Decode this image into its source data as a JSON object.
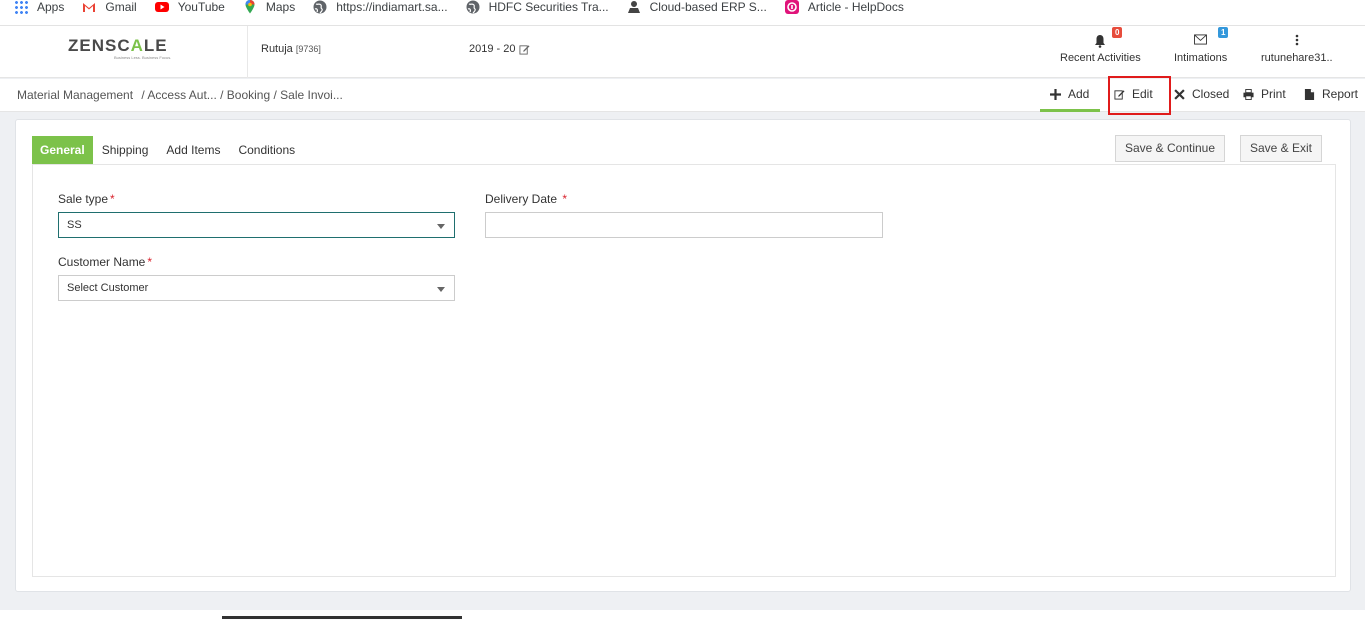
{
  "bookmarks": [
    {
      "label": "Apps",
      "icon": "apps-grid-icon"
    },
    {
      "label": "Gmail",
      "icon": "gmail-icon"
    },
    {
      "label": "YouTube",
      "icon": "youtube-icon"
    },
    {
      "label": "Maps",
      "icon": "maps-icon"
    },
    {
      "label": "https://indiamart.sa...",
      "icon": "globe-icon"
    },
    {
      "label": "HDFC Securities Tra...",
      "icon": "globe-icon"
    },
    {
      "label": "Cloud-based ERP S...",
      "icon": "erp-icon"
    },
    {
      "label": "Article - HelpDocs",
      "icon": "helpdocs-icon"
    }
  ],
  "header": {
    "logo_text_left": "ZENSC",
    "logo_text_accent": "A",
    "logo_text_right": "LE",
    "logo_tagline": "Business Less. Business Focus.",
    "user": "Rutuja",
    "user_id": "[9736]",
    "year": "2019 - 20",
    "recent_activities": {
      "label": "Recent Activities",
      "badge": "0"
    },
    "intimations": {
      "label": "Intimations",
      "badge": "1"
    },
    "account": {
      "label": "rutunehare31.."
    }
  },
  "breadcrumb": {
    "root": "Material Management",
    "path": "/ Access Aut... / Booking / Sale Invoi..."
  },
  "actions": {
    "add": "Add",
    "edit": "Edit",
    "closed": "Closed",
    "print": "Print",
    "report": "Report"
  },
  "tabs": [
    "General",
    "Shipping",
    "Add Items",
    "Conditions"
  ],
  "buttons": {
    "save_continue": "Save & Continue",
    "save_exit": "Save & Exit"
  },
  "form": {
    "sale_type": {
      "label": "Sale type",
      "required": "*",
      "value": "SS"
    },
    "delivery_date": {
      "label": "Delivery Date",
      "required": "*",
      "value": ""
    },
    "customer_name": {
      "label": "Customer Name",
      "required": "*",
      "value": "Select Customer"
    }
  },
  "colors": {
    "accent_green": "#7cc24a",
    "highlight_red": "#e01b1b",
    "badge_red": "#e74c3c",
    "badge_blue": "#3498db"
  }
}
